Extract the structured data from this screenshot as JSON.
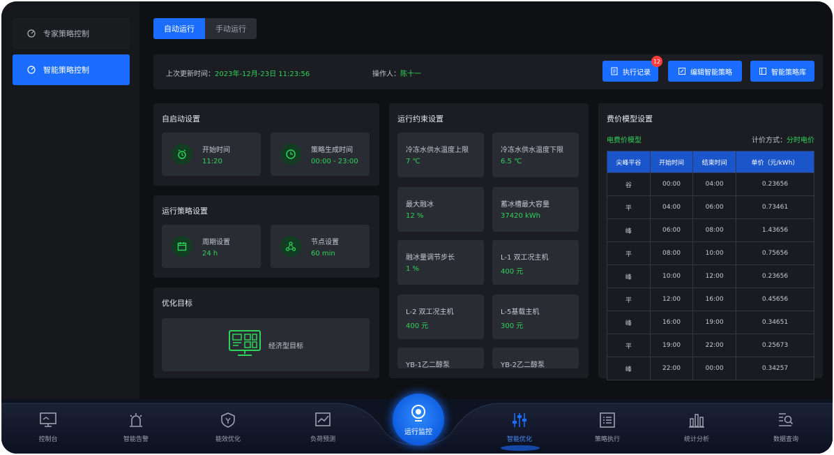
{
  "sidebar": {
    "items": [
      {
        "label": "专家策略控制",
        "active": false
      },
      {
        "label": "智能策略控制",
        "active": true
      }
    ]
  },
  "tabs": [
    {
      "label": "自动运行",
      "active": true
    },
    {
      "label": "手动运行",
      "active": false
    }
  ],
  "info": {
    "update_label": "上次更新时间：",
    "update_value": "2023年-12月-23日  11:23:56",
    "operator_label": "操作人：",
    "operator_value": "陈十一"
  },
  "buttons": {
    "exec_log": "执行记录",
    "exec_log_badge": "12",
    "edit_strategy": "编辑智能策略",
    "strategy_lib": "智能策略库"
  },
  "auto_start": {
    "title": "自启动设置",
    "items": [
      {
        "label": "开始时间",
        "value": "11:20"
      },
      {
        "label": "策略生成时间",
        "value": "00:00 - 23:00"
      }
    ]
  },
  "run_strategy": {
    "title": "运行策略设置",
    "items": [
      {
        "label": "周期设置",
        "value": "24 h"
      },
      {
        "label": "节点设置",
        "value": "60 min"
      }
    ]
  },
  "optimize": {
    "title": "优化目标",
    "label": "经济型目标"
  },
  "constraints": {
    "title": "运行约束设置",
    "items": [
      {
        "label": "冷冻水供水温度上限",
        "value": "7 ℃"
      },
      {
        "label": "冷冻水供水温度下限",
        "value": "6.5 ℃"
      },
      {
        "label": "最大融冰",
        "value": "12 %"
      },
      {
        "label": "蓄冰槽最大容量",
        "value": "37420 kWh"
      },
      {
        "label": "融冰量调节步长",
        "value": "1 %"
      },
      {
        "label": "L-1 双工况主机",
        "value": "400 元"
      },
      {
        "label": "L-2 双工况主机",
        "value": "400 元"
      },
      {
        "label": "L-5基载主机",
        "value": "300 元"
      },
      {
        "label": "YB-1乙二醇泵",
        "value": ""
      },
      {
        "label": "YB-2乙二醇泵",
        "value": ""
      }
    ]
  },
  "price_model": {
    "title": "费价模型设置",
    "model_label": "电费价模型",
    "method_label": "计价方式：",
    "method_value": "分时电价",
    "headers": [
      "尖峰平谷",
      "开始时间",
      "结束时间",
      "单价（元/kWh）"
    ],
    "rows": [
      [
        "谷",
        "00:00",
        "04:00",
        "0.23656"
      ],
      [
        "平",
        "04:00",
        "06:00",
        "0.73461"
      ],
      [
        "峰",
        "06:00",
        "08:00",
        "1.43656"
      ],
      [
        "平",
        "08:00",
        "10:00",
        "0.75656"
      ],
      [
        "峰",
        "10:00",
        "12:00",
        "0.23656"
      ],
      [
        "平",
        "12:00",
        "16:00",
        "0.45656"
      ],
      [
        "峰",
        "16:00",
        "19:00",
        "0.34651"
      ],
      [
        "平",
        "19:00",
        "22:00",
        "0.25673"
      ],
      [
        "峰",
        "22:00",
        "00:00",
        "0.34257"
      ]
    ]
  },
  "bottom_nav": [
    {
      "label": "控制台",
      "icon": "monitor-icon",
      "active": false
    },
    {
      "label": "智能告警",
      "icon": "alarm-icon",
      "active": false
    },
    {
      "label": "能效优化",
      "icon": "shield-icon",
      "active": false
    },
    {
      "label": "负荷预测",
      "icon": "chart-icon",
      "active": false
    },
    {
      "label": "运行监控",
      "icon": "camera-icon",
      "active": false
    },
    {
      "label": "智能优化",
      "icon": "sliders-icon",
      "active": true
    },
    {
      "label": "策略执行",
      "icon": "list-icon",
      "active": false
    },
    {
      "label": "统计分析",
      "icon": "bars-icon",
      "active": false
    },
    {
      "label": "数据查询",
      "icon": "search-icon",
      "active": false
    }
  ],
  "colors": {
    "accent": "#1a6dff",
    "value_green": "#2fd35a",
    "panel": "#1c1d22",
    "card": "#2a2c33",
    "badge": "#ff3b3b"
  }
}
